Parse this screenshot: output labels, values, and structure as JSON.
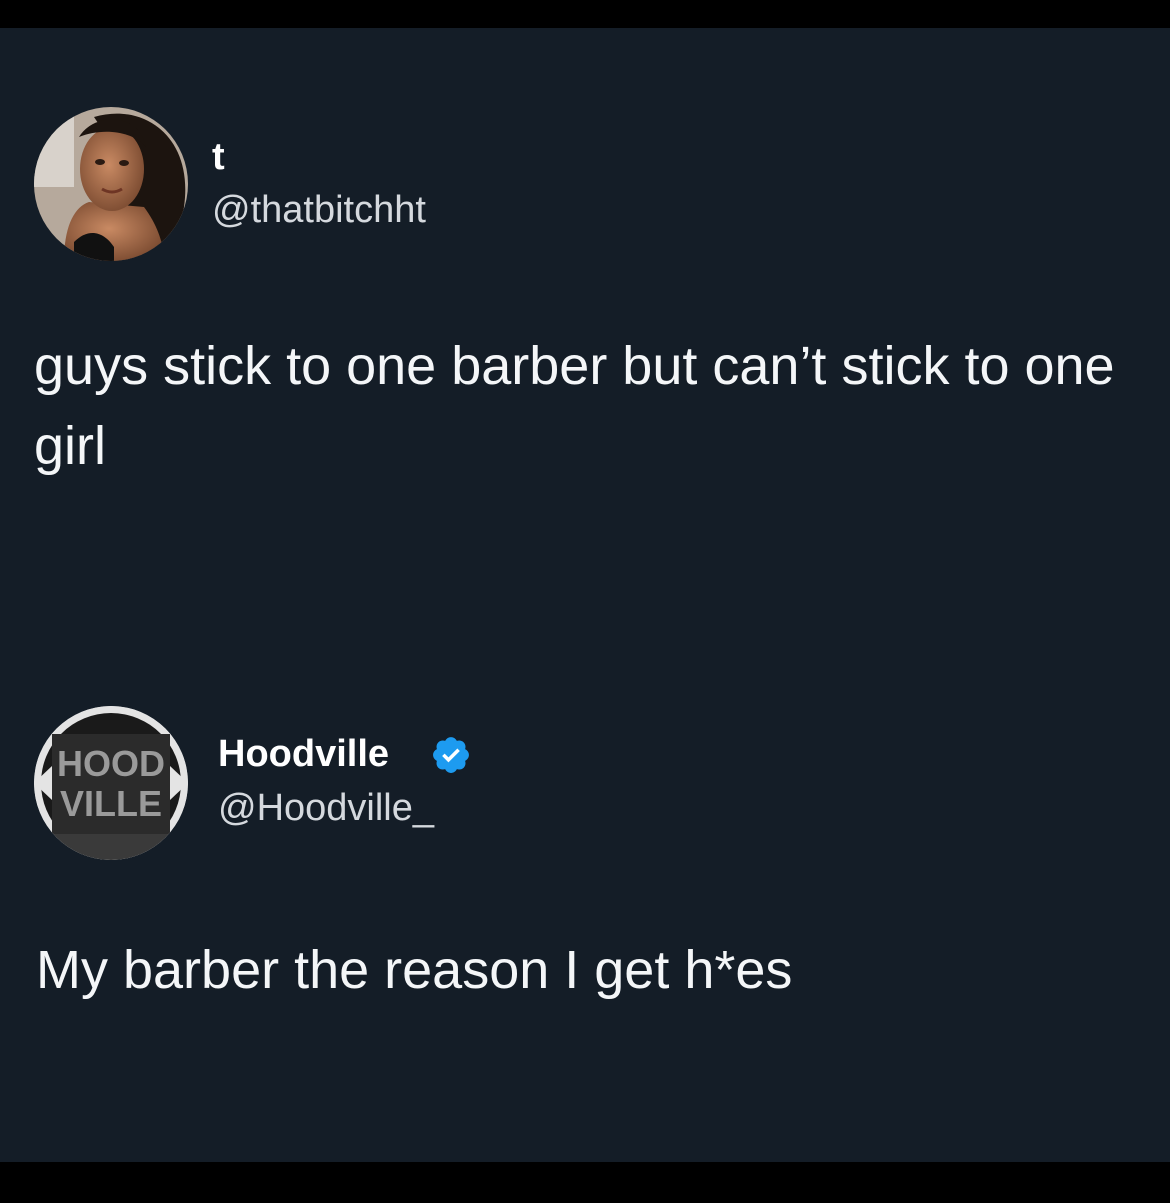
{
  "colors": {
    "background": "#141d27",
    "letterbox": "#000000",
    "text": "#f4f6f8",
    "handle": "#d5d9de",
    "verified_blue": "#1d9bf0"
  },
  "tweets": [
    {
      "display_name": "t",
      "handle": "@thatbitchht",
      "text": "guys stick to one barber but can’t stick to one girl",
      "avatar_icon": "profile-photo"
    },
    {
      "display_name": "Hoodville",
      "handle": "@Hoodville_",
      "verified": true,
      "verified_icon": "verified-badge-icon",
      "text": "My barber the reason I get h*es",
      "avatar_icon": "hoodville-logo",
      "avatar_logo_lines": [
        "HOOD",
        "VILLE"
      ]
    }
  ]
}
